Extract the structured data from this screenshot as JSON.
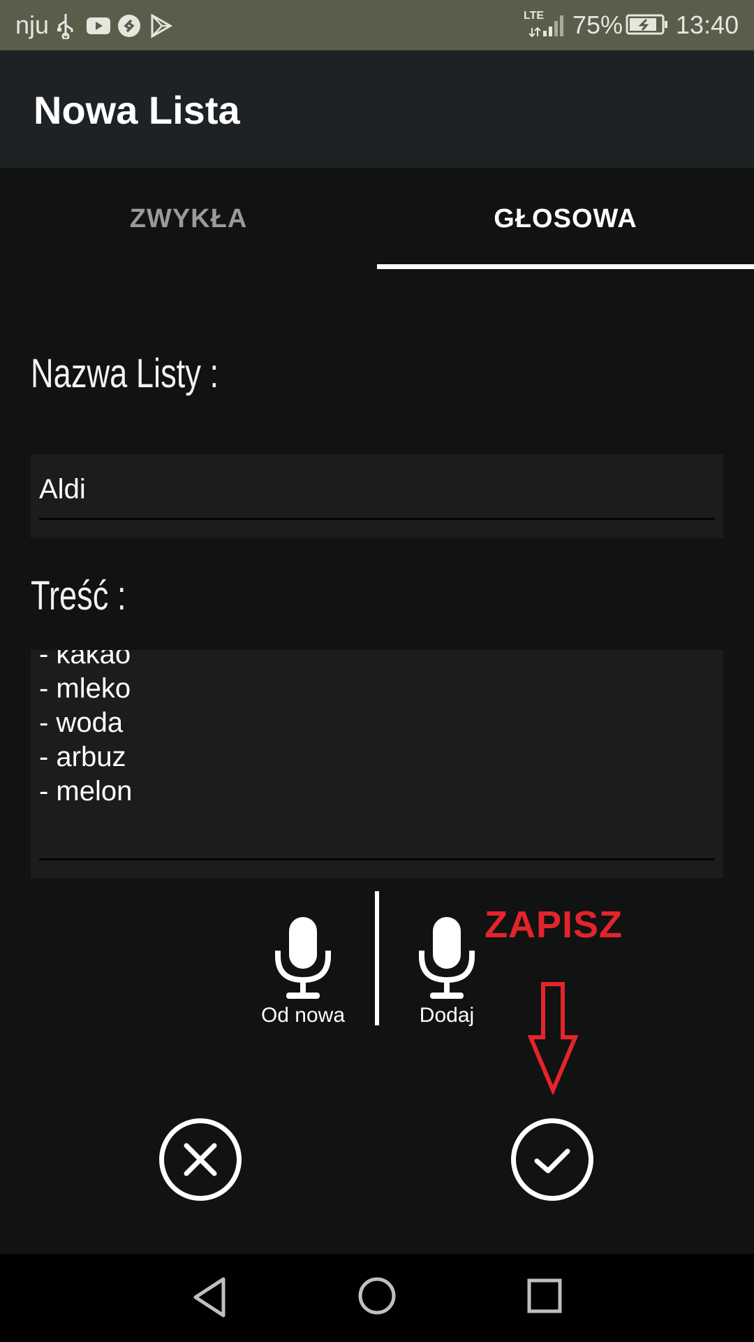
{
  "status_bar": {
    "carrier": "nju",
    "network": "LTE",
    "battery": "75%",
    "time": "13:40"
  },
  "app_bar": {
    "title": "Nowa Lista"
  },
  "tabs": [
    {
      "label": "ZWYKŁA",
      "selected": false
    },
    {
      "label": "GŁOSOWA",
      "selected": true
    }
  ],
  "form": {
    "name_label": "Nazwa Listy :",
    "name_value": "Aldi",
    "content_label": "Treść :",
    "content_lines": [
      "- kakao",
      "- mleko",
      "- woda",
      "- arbuz",
      "- melon"
    ]
  },
  "voice_buttons": {
    "restart_label": "Od nowa",
    "add_label": "Dodaj"
  },
  "annotation": {
    "text": "ZAPISZ",
    "color": "#e3242b"
  },
  "actions": {
    "cancel_icon": "close-icon",
    "confirm_icon": "check-icon"
  },
  "colors": {
    "background": "#111212",
    "status_bar": "#5c5c4b",
    "app_bar": "#1f2224",
    "field": "#1b1c1b"
  }
}
